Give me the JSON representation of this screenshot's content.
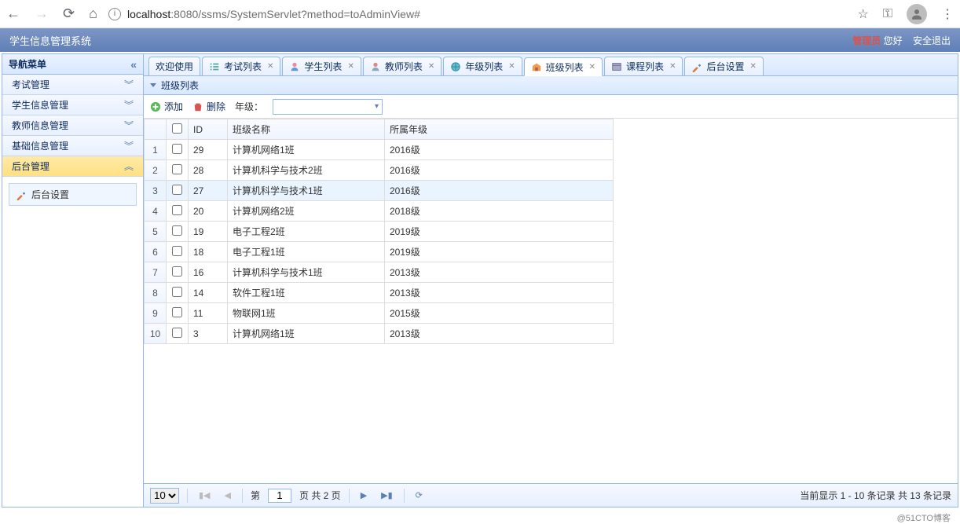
{
  "browser": {
    "url_host": "localhost",
    "url_port": ":8080",
    "url_path": "/ssms/SystemServlet?method=toAdminView#"
  },
  "header": {
    "title": "学生信息管理系统",
    "admin_label": "管理员",
    "greeting": "您好",
    "logout": "安全退出"
  },
  "sidebar": {
    "title": "导航菜单",
    "items": [
      {
        "label": "考试管理",
        "expanded": false
      },
      {
        "label": "学生信息管理",
        "expanded": false
      },
      {
        "label": "教师信息管理",
        "expanded": false
      },
      {
        "label": "基础信息管理",
        "expanded": false
      },
      {
        "label": "后台管理",
        "expanded": true
      }
    ],
    "submenu": {
      "label": "后台设置"
    }
  },
  "tabs": [
    {
      "label": "欢迎使用",
      "closeable": false,
      "icon": "none"
    },
    {
      "label": "考试列表",
      "closeable": true,
      "icon": "list"
    },
    {
      "label": "学生列表",
      "closeable": true,
      "icon": "student"
    },
    {
      "label": "教师列表",
      "closeable": true,
      "icon": "teacher"
    },
    {
      "label": "年级列表",
      "closeable": true,
      "icon": "grade"
    },
    {
      "label": "班级列表",
      "closeable": true,
      "icon": "class",
      "active": true
    },
    {
      "label": "课程列表",
      "closeable": true,
      "icon": "course"
    },
    {
      "label": "后台设置",
      "closeable": true,
      "icon": "settings"
    }
  ],
  "panel": {
    "title": "班级列表"
  },
  "toolbar": {
    "add": "添加",
    "del": "删除",
    "grade_label": "年级："
  },
  "table": {
    "columns": {
      "id": "ID",
      "name": "班级名称",
      "grade": "所属年级"
    },
    "rows": [
      {
        "num": 1,
        "id": 29,
        "name": "计算机网络1班",
        "grade": "2016级"
      },
      {
        "num": 2,
        "id": 28,
        "name": "计算机科学与技术2班",
        "grade": "2016级"
      },
      {
        "num": 3,
        "id": 27,
        "name": "计算机科学与技术1班",
        "grade": "2016级",
        "hover": true
      },
      {
        "num": 4,
        "id": 20,
        "name": "计算机网络2班",
        "grade": "2018级"
      },
      {
        "num": 5,
        "id": 19,
        "name": "电子工程2班",
        "grade": "2019级"
      },
      {
        "num": 6,
        "id": 18,
        "name": "电子工程1班",
        "grade": "2019级"
      },
      {
        "num": 7,
        "id": 16,
        "name": "计算机科学与技术1班",
        "grade": "2013级"
      },
      {
        "num": 8,
        "id": 14,
        "name": "软件工程1班",
        "grade": "2013级"
      },
      {
        "num": 9,
        "id": 11,
        "name": "物联网1班",
        "grade": "2015级"
      },
      {
        "num": 10,
        "id": 3,
        "name": "计算机网络1班",
        "grade": "2013级"
      }
    ]
  },
  "pager": {
    "page_size": "10",
    "page_prefix": "第",
    "current_page": "1",
    "page_suffix": "页 共 2 页",
    "status": "当前显示 1 - 10 条记录 共 13 条记录"
  },
  "watermark": "@51CTO博客"
}
